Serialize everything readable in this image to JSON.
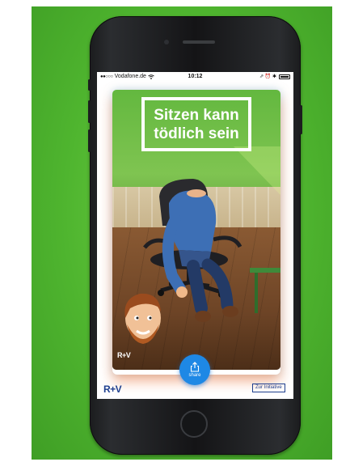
{
  "status_bar": {
    "carrier": "Vodafone.de",
    "signal": "●●○○○",
    "time": "10:12",
    "indicators": "⇗ ⏰ ✱"
  },
  "poster": {
    "headline_line1": "Sitzen kann",
    "headline_line2": "tödlich sein",
    "card_logo": "R+V"
  },
  "actions": {
    "share_label": "share",
    "initiative_label": "Zur Initiative"
  },
  "footer": {
    "logo": "R+V"
  },
  "icons": {
    "wifi": "wifi-icon",
    "share": "share-icon",
    "battery": "battery-icon",
    "home": "home-button"
  },
  "colors": {
    "background_green": "#4fb52f",
    "brand_blue": "#1d3f8f",
    "share_blue": "#1e88e5"
  }
}
